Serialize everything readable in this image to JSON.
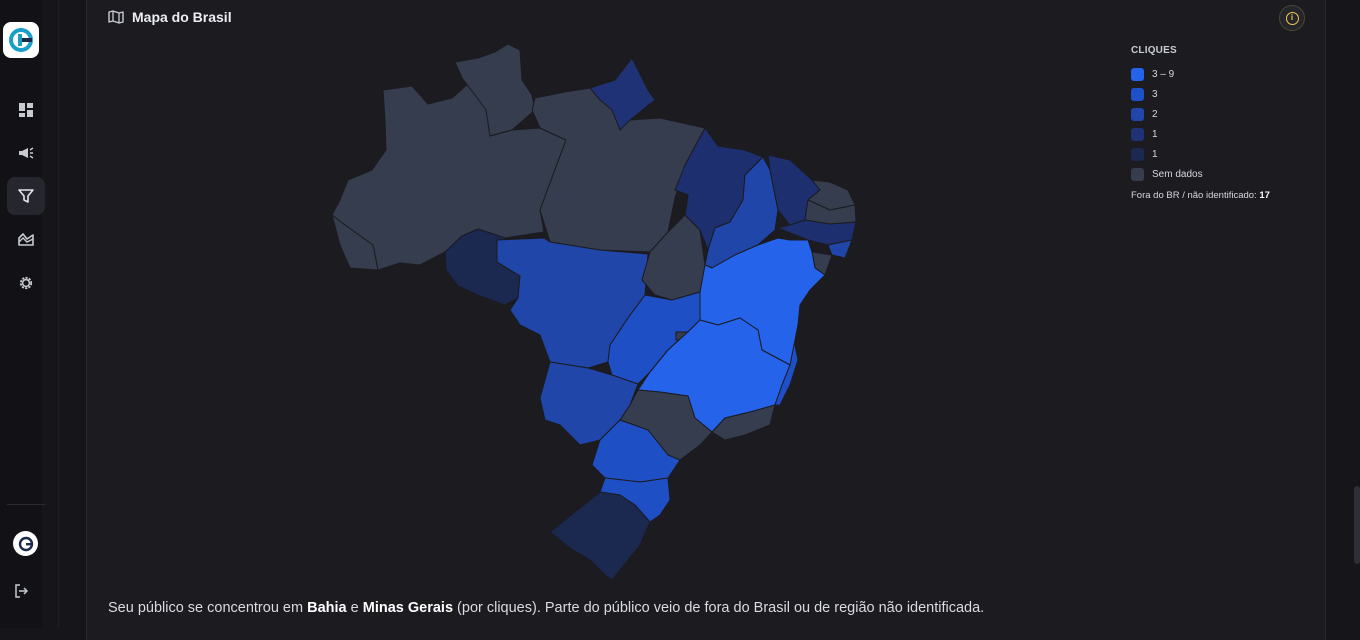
{
  "sidebar": {
    "logo_icon": "brand-logo-icon",
    "items": [
      {
        "name": "dashboard",
        "icon": "dashboard-icon"
      },
      {
        "name": "campaigns",
        "icon": "megaphone-icon"
      },
      {
        "name": "filters",
        "icon": "filter-icon",
        "active": true
      },
      {
        "name": "analytics",
        "icon": "area-chart-icon"
      },
      {
        "name": "settings",
        "icon": "gear-icon"
      }
    ],
    "bottom": [
      "avatar",
      "logout-icon"
    ]
  },
  "card": {
    "title": "Mapa do Brasil",
    "title_icon": "map-icon",
    "info_icon": "info-icon",
    "info_glyph": "i"
  },
  "legend": {
    "title": "CLIQUES",
    "items": [
      {
        "label": "3 – 9",
        "color": "#2563eb"
      },
      {
        "label": "3",
        "color": "#1e50c8"
      },
      {
        "label": "2",
        "color": "#1f46a8"
      },
      {
        "label": "1",
        "color": "#1f3275"
      },
      {
        "label": "1",
        "color": "#1b2850"
      },
      {
        "label": "Sem dados",
        "color": "#363d4e"
      }
    ],
    "note_prefix": "Fora do BR / não identificado:",
    "note_value": "17"
  },
  "colors": {
    "top": "#2563eb",
    "mid": "#1f4fc4",
    "lowmid": "#1f46a8",
    "low": "#1d2f6e",
    "lowest": "#1b2850",
    "nodata": "#363d4e"
  },
  "summary": {
    "prefix": "Seu público se concentrou em",
    "state1": "Bahia",
    "joiner": "e",
    "state2": "Minas Gerais",
    "suffix": "(por cliques). Parte do público veio de fora do Brasil ou de região não identificada."
  }
}
